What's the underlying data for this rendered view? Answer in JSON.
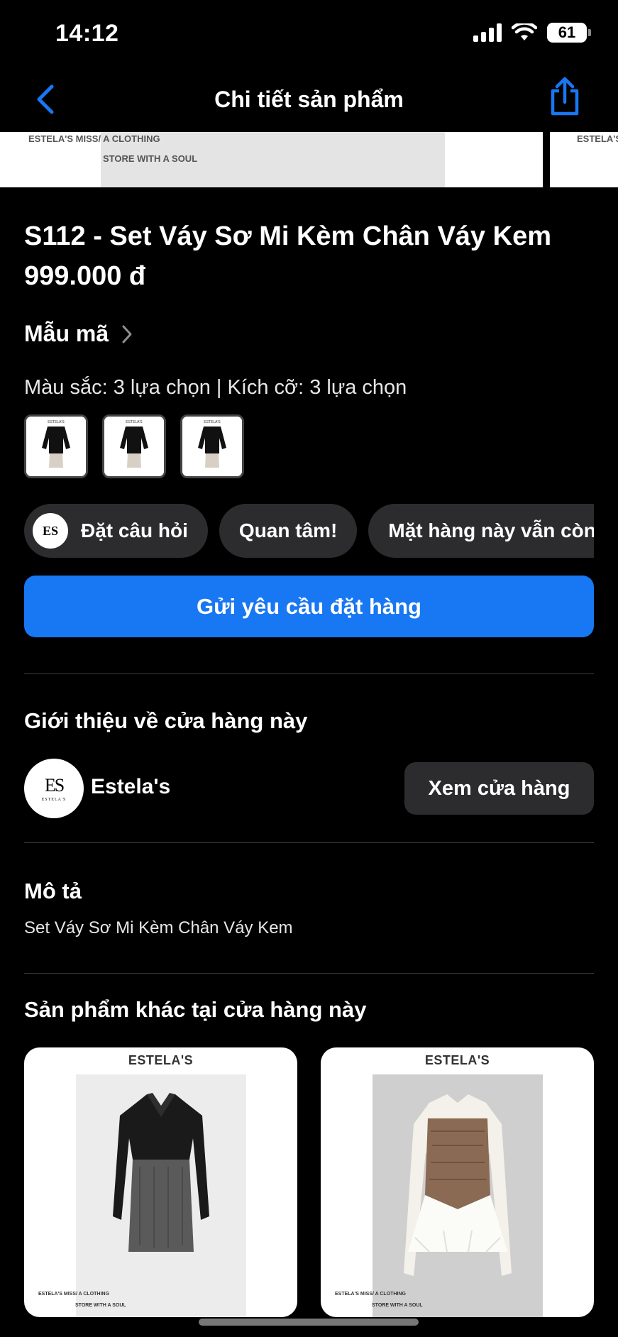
{
  "status_bar": {
    "time": "14:12",
    "battery": "61"
  },
  "nav": {
    "title": "Chi tiết sản phẩm",
    "back_icon": "chevron-left-icon",
    "share_icon": "share-icon"
  },
  "hero": {
    "brand_line_1": "ESTELA'S MISS/ A CLOTHING",
    "brand_line_2": "STORE WITH A SOUL",
    "brand_right": "ESTELA'S"
  },
  "product": {
    "title": "S112 - Set Váy Sơ Mi Kèm Chân Váy Kem",
    "price": "999.000 đ",
    "variants_label": "Mẫu mã",
    "options_summary": "Màu sắc: 3 lựa chọn | Kích cỡ: 3 lựa chọn",
    "thumb_brand": "ESTELA'S"
  },
  "quick_replies": {
    "avatar_text": "ES",
    "items": [
      "Đặt câu hỏi",
      "Quan tâm!",
      "Mặt hàng này vẫn còn chứ?"
    ]
  },
  "order_button": "Gửi yêu cầu đặt hàng",
  "shop": {
    "section_title": "Giới thiệu về cửa hàng này",
    "logo_text": "ES",
    "logo_sub": "ESTELA'S",
    "name": "Estela's",
    "view_button": "Xem cửa hàng"
  },
  "description": {
    "title": "Mô tả",
    "text": "Set Váy Sơ Mi Kèm Chân Váy Kem"
  },
  "more_products": {
    "title": "Sản phẩm khác tại cửa hàng này",
    "cards": [
      {
        "brand": "ESTELA'S",
        "foot_1": "ESTELA'S MISS/ A CLOTHING",
        "foot_2": "STORE WITH A SOUL"
      },
      {
        "brand": "ESTELA'S",
        "foot_1": "ESTELA'S MISS/ A CLOTHING",
        "foot_2": "STORE WITH A SOUL"
      }
    ]
  },
  "colors": {
    "accent": "#1877f2",
    "chip_bg": "#2c2c2e",
    "background": "#000000"
  }
}
